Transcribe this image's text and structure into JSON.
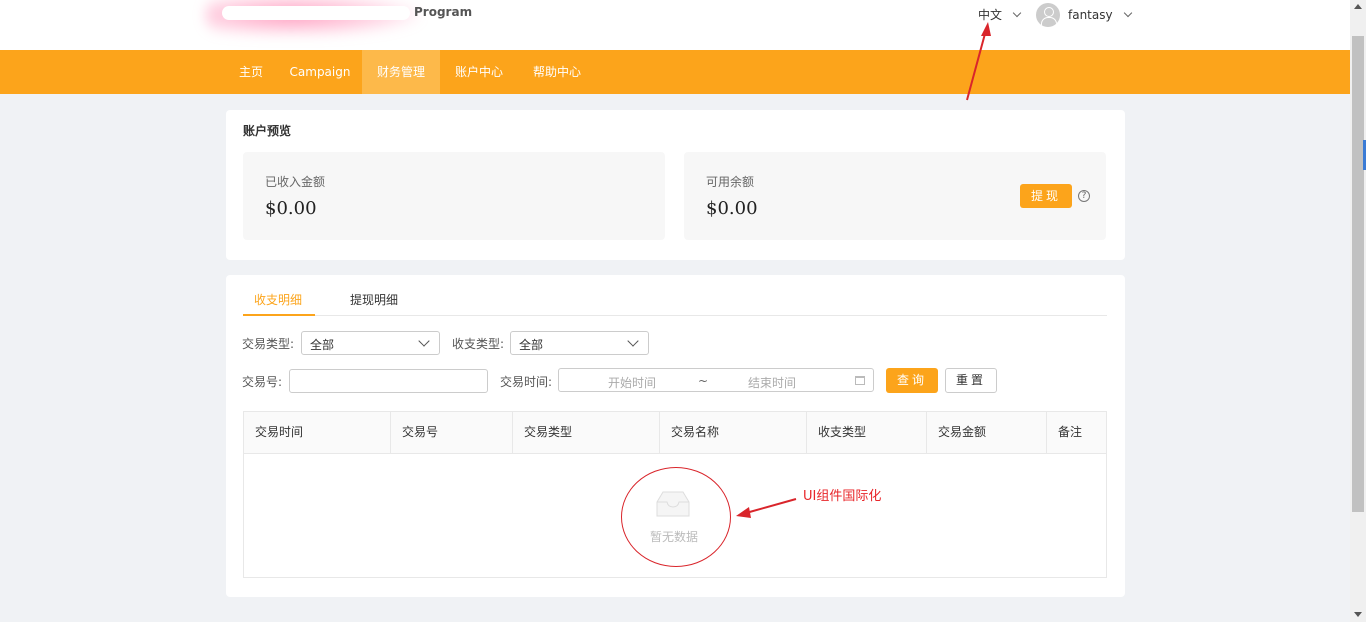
{
  "header": {
    "logo_suffix": "Program",
    "language": "中文",
    "username": "fantasy"
  },
  "nav": {
    "items": [
      {
        "label": "主页"
      },
      {
        "label": "Campaign"
      },
      {
        "label": "财务管理",
        "active": true
      },
      {
        "label": "账户中心"
      },
      {
        "label": "帮助中心"
      }
    ]
  },
  "overview": {
    "title": "账户预览",
    "income_label": "已收入金额",
    "income_value": "$0.00",
    "balance_label": "可用余额",
    "balance_value": "$0.00",
    "withdraw_button": "提现",
    "help_glyph": "?"
  },
  "tabs": [
    {
      "label": "收支明细",
      "active": true
    },
    {
      "label": "提现明细"
    }
  ],
  "filters": {
    "trade_type_label": "交易类型:",
    "trade_type_value": "全部",
    "io_type_label": "收支类型:",
    "io_type_value": "全部",
    "trade_no_label": "交易号:",
    "trade_no_value": "",
    "trade_time_label": "交易时间:",
    "start_placeholder": "开始时间",
    "range_separator": "~",
    "end_placeholder": "结束时间",
    "query_button": "查询",
    "reset_button": "重置"
  },
  "table": {
    "columns": [
      "交易时间",
      "交易号",
      "交易类型",
      "交易名称",
      "收支类型",
      "交易金额",
      "备注"
    ],
    "empty_text": "暂无数据"
  },
  "annotation": {
    "text": "UI组件国际化",
    "color": "#e8262a"
  },
  "colors": {
    "accent": "#fca41b",
    "background": "#f0f2f5"
  }
}
